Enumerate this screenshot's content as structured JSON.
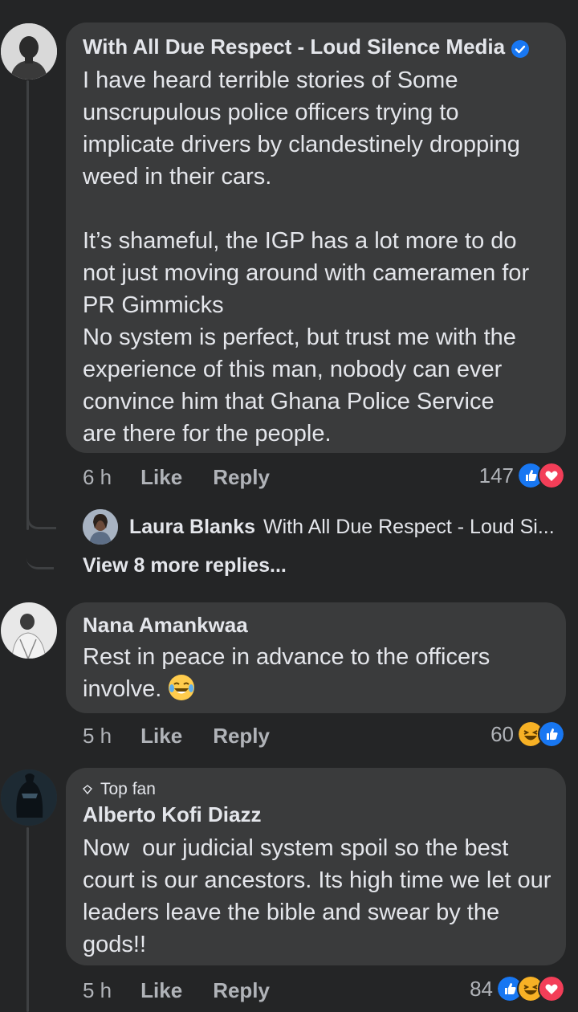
{
  "comments": [
    {
      "author": "With All Due Respect - Loud Silence Media",
      "verified": true,
      "text": "I have heard terrible stories of Some unscrupulous police officers trying to implicate drivers by clandestinely dropping weed in their cars.\n\nIt’s shameful, the IGP has a lot more to do not just moving around with cameramen for PR Gimmicks\nNo system is perfect, but trust me with the experience of this man, nobody can ever convince him that Ghana Police Service are there for the people.",
      "time": "6 h",
      "like_label": "Like",
      "reply_label": "Reply",
      "reaction_count": "147",
      "reactions": [
        "like-icon",
        "love-icon"
      ]
    },
    {
      "author": "Nana Amankwaa",
      "text": "Rest in peace in advance to the officers involve. ",
      "text_emoji": "laughing-tears-emoji",
      "time": "5 h",
      "like_label": "Like",
      "reply_label": "Reply",
      "reaction_count": "60",
      "reactions": [
        "haha-icon",
        "like-icon"
      ]
    },
    {
      "badge": "Top fan",
      "author": "Alberto Kofi Diazz",
      "text": "Now  our judicial system spoil so the best court is our ancestors. Its high time we let our leaders leave the bible and swear by the gods!!",
      "time": "5 h",
      "like_label": "Like",
      "reply_label": "Reply",
      "reaction_count": "84",
      "reactions": [
        "like-icon",
        "haha-icon",
        "love-icon"
      ]
    }
  ],
  "reply_preview": {
    "author": "Laura Blanks",
    "text": "With All Due Respect - Loud Si..."
  },
  "view_more_label": "View 8 more replies...",
  "colors": {
    "background": "#242526",
    "bubble": "#3a3b3c",
    "primary_text": "#e4e6eb",
    "secondary_text": "#b0b3b8",
    "like_blue": "#1877f2",
    "love_red": "#f33e58",
    "haha_yellow": "#f7b125"
  }
}
